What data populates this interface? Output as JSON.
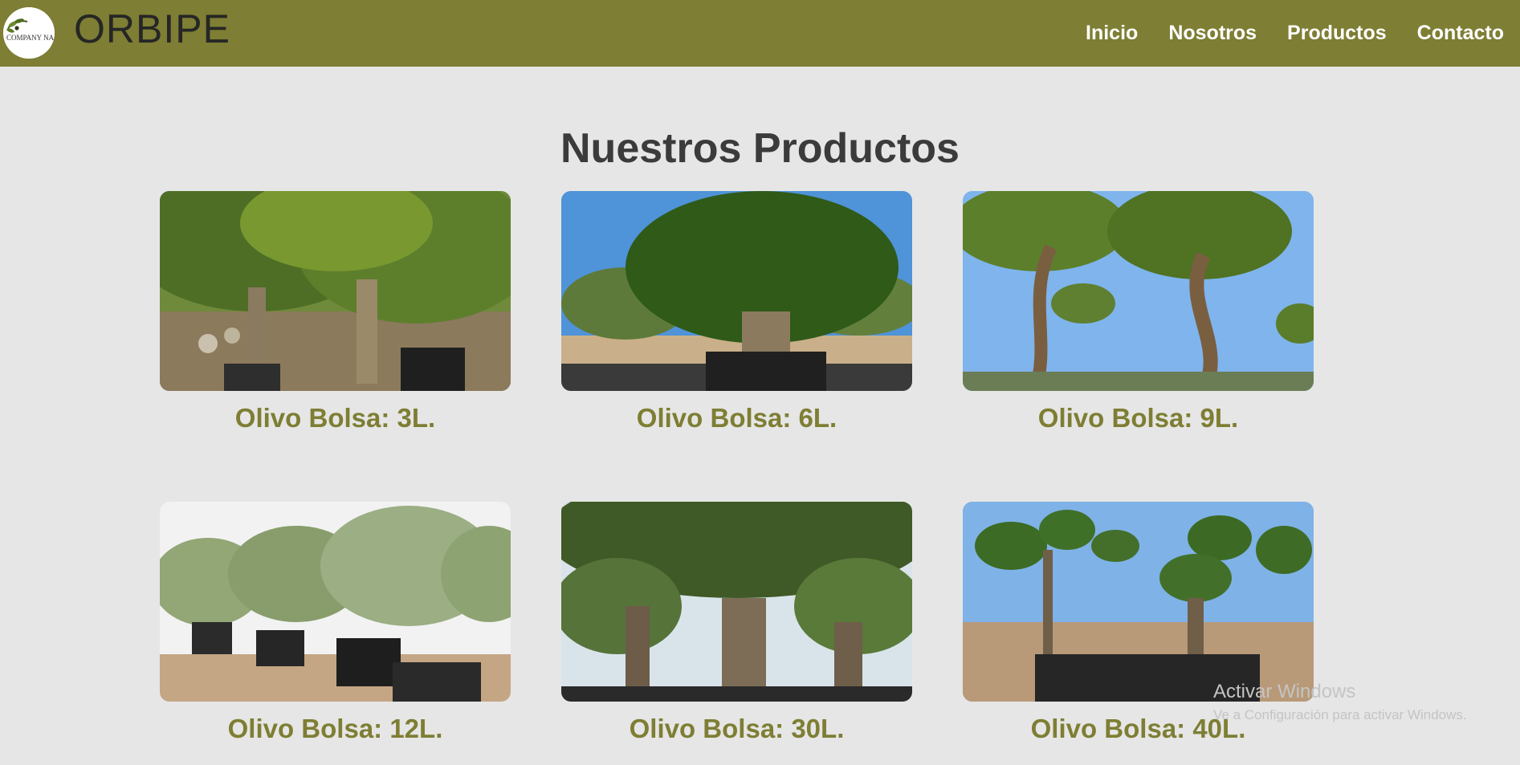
{
  "header": {
    "logo_text": "COMPANY NA",
    "brand": "ORBIPE",
    "nav": [
      "Inicio",
      "Nosotros",
      "Productos",
      "Contacto"
    ]
  },
  "products": {
    "title": "Nuestros Productos",
    "items": [
      {
        "label": "Olivo Bolsa: 3L."
      },
      {
        "label": "Olivo Bolsa: 6L."
      },
      {
        "label": "Olivo Bolsa: 9L."
      },
      {
        "label": "Olivo Bolsa: 12L."
      },
      {
        "label": "Olivo Bolsa: 30L."
      },
      {
        "label": "Olivo Bolsa: 40L."
      }
    ]
  },
  "watermark": {
    "title": "Activar Windows",
    "subtitle": "Ve a Configuración para activar Windows."
  },
  "colors": {
    "navbar": "#7e7e34",
    "background": "#e6e6e6",
    "accent_text": "#7e7e34",
    "heading": "#3b3b3b"
  }
}
